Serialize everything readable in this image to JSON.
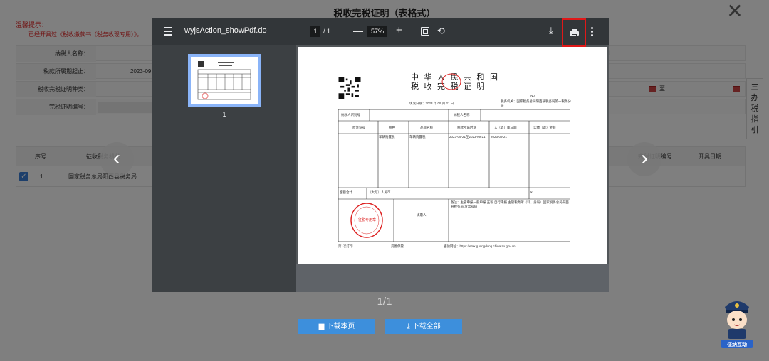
{
  "page_title": "税收完税证明（表格式）",
  "tips": {
    "title": "温馨提示：",
    "body": "已经开具过《税收缴款书（税务收现专用）》，"
  },
  "form": {
    "taxpayer_label": "纳税人名称：",
    "period_label": "税款所属期起止：",
    "period_value": "2023-09",
    "cert_type_label": "税收完税证明种类：",
    "cert_no_label": "完税证明编号：",
    "right_value": "1",
    "date_to": "至"
  },
  "side_guide": [
    "三",
    "办",
    "税",
    "指",
    "引"
  ],
  "table": {
    "headers": [
      "序号",
      "征收税务机关",
      "完税证明编号",
      "开具日期"
    ],
    "row": {
      "index": "1",
      "office": "国家税务总局阳西县税务局"
    }
  },
  "viewer": {
    "doc_title": "wyjsAction_showPdf.do",
    "current_page": "1",
    "total_pages": "/ 1",
    "zoom": "57%",
    "thumb_number": "1"
  },
  "certificate": {
    "title_line1": "中 华 人 民 共 和 国",
    "title_line2": "税 收 完 税 证 明",
    "fill_date": "填发日期：2023 年 09 月 21 日",
    "tax_authority": "税务机关：国家税务总局阳西县税务局第一税务分局",
    "no_label": "No.",
    "taxpayer_id_label": "纳税人识别号",
    "taxpayer_name_label": "纳税人名称",
    "col_headers": [
      "原凭证号",
      "税种",
      "品目名称",
      "税款所属时期",
      "入（退）库日期",
      "实缴（退）金额"
    ],
    "tax_type": "车辆购置税",
    "item_name": "车辆购置税",
    "period": "2023-09-21至2023-09-21",
    "storage_date": "2023-09-21",
    "total_label": "金额合计",
    "total_value": "（大写）人民币",
    "currency": "¥",
    "remark": "备注：主管申报一般申报 正税 自行申报 主管税务所（科、分局）国家税务总局阳西县税务局 发票号码：",
    "filler_label": "填票人：",
    "seal_text": "征税专用章",
    "footer_left": "第1次打印",
    "footer_mid": "妥善保管",
    "footer_right": "查验网址：https://etax.guangdong.chinatax.gov.cn"
  },
  "pager": "1/1",
  "buttons": {
    "download_page": "下载本页",
    "download_all": "下载全部"
  },
  "mascot_label": "征纳互动"
}
